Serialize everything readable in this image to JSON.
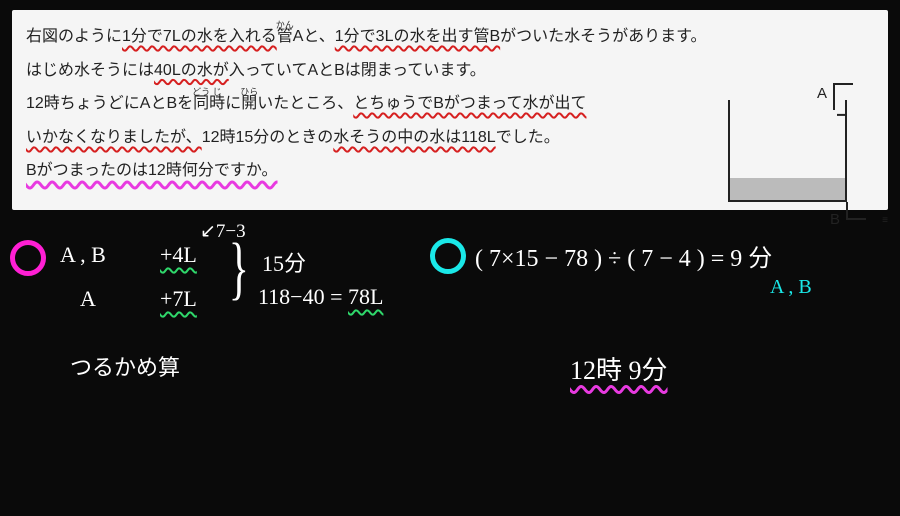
{
  "problem": {
    "line1_pre": "右図のように",
    "line1_u1": "1分で7Lの水を入れる",
    "line1_ruby1": "管",
    "line1_ruby1_top": "かん",
    "line1_a": "Aと、",
    "line1_u2": "1分で3Lの水を出す管B",
    "line1_post": "がついた水そうがあります。",
    "line2_pre": "はじめ水そうには",
    "line2_u1": "40Lの水が",
    "line2_post": "入っていてAとBは閉まっています。",
    "line3_pre": "12時ちょうどにAとBを",
    "line3_ruby1": "同",
    "line3_ruby1_top": "どう",
    "line3_ruby2": "時",
    "line3_ruby2_top": "じ",
    "line3_mid": "に",
    "line3_ruby3": "開",
    "line3_ruby3_top": "ひら",
    "line3_mid2": "いたところ、",
    "line3_u1": "とちゅうでBがつまって水が出て",
    "line4_u1": "いかなくなりましたが、",
    "line4_mid": "12時15分のときの",
    "line4_u2": "水そうの中の水は118L",
    "line4_post": "でした。",
    "line5_u": "Bがつまったのは12時何分ですか。"
  },
  "diagram": {
    "label_a": "A",
    "label_b": "B"
  },
  "work": {
    "note_top": "7−3",
    "row1_label": "A , B",
    "row1_val": "+4L",
    "row2_label": "A",
    "row2_val": "+7L",
    "minutes": "15分",
    "diff": "118−40 = 78L",
    "method": "つるかめ算",
    "equation": "( 7×15 − 78 ) ÷ ( 7 − 4 )  =  9 分",
    "eq_label": "A , B",
    "answer": "12時 9分"
  }
}
